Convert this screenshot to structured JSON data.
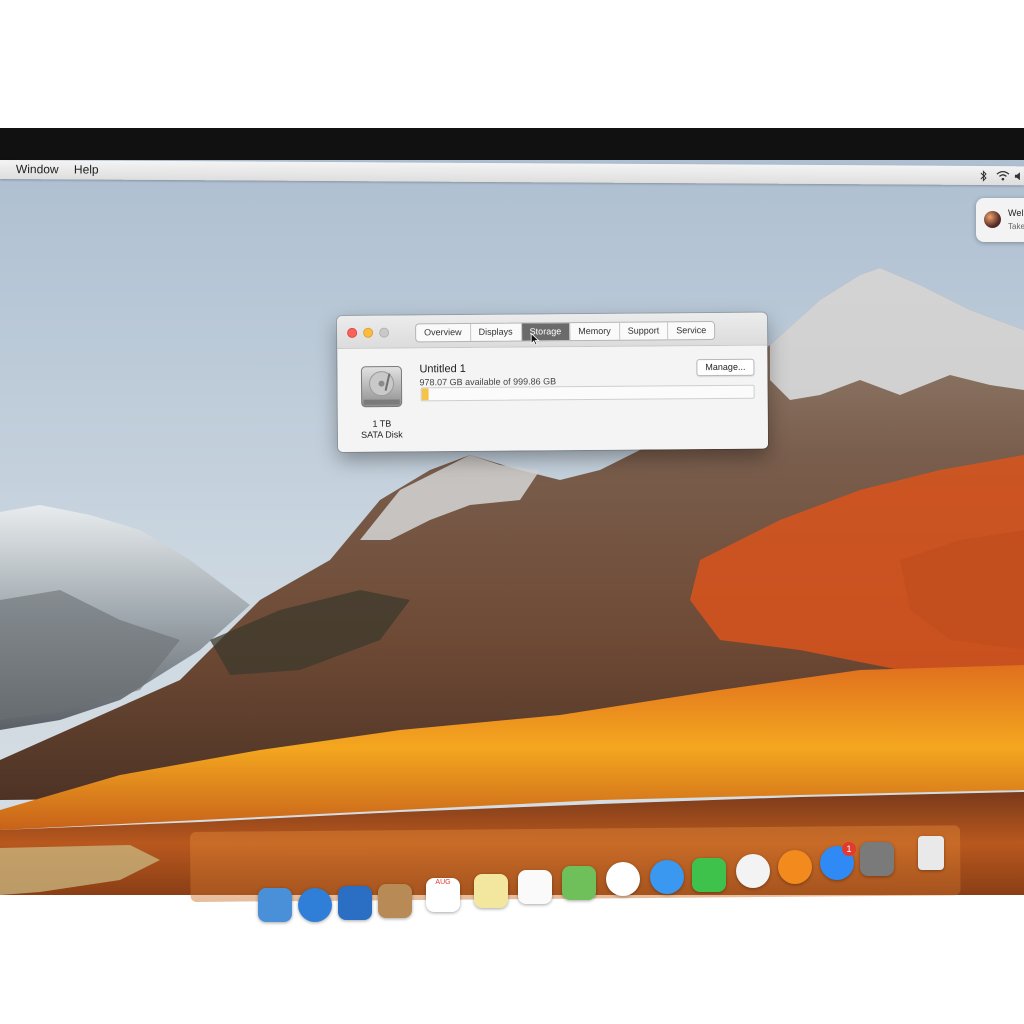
{
  "menubar": {
    "items": [
      {
        "label": "Window"
      },
      {
        "label": "Help"
      }
    ]
  },
  "notification": {
    "title": "Wel",
    "subtitle": "Take"
  },
  "window": {
    "tabs": [
      {
        "label": "Overview",
        "active": false
      },
      {
        "label": "Displays",
        "active": false
      },
      {
        "label": "Storage",
        "active": true
      },
      {
        "label": "Memory",
        "active": false
      },
      {
        "label": "Support",
        "active": false
      },
      {
        "label": "Service",
        "active": false
      }
    ],
    "disk": {
      "size": "1 TB",
      "type": "SATA Disk"
    },
    "volume": {
      "name": "Untitled 1",
      "availability": "978.07 GB available of 999.86 GB",
      "used_fraction": 0.022
    },
    "manage_label": "Manage...",
    "colors": {
      "bar_fill": "#f5c34a",
      "close": "#fc605c",
      "minimize": "#fdbc40",
      "zoom": "#c9c9c9"
    }
  },
  "dock": {
    "calendar_month": "AUG",
    "app_store_badge": "1",
    "icons": [
      "finder-icon",
      "safari-icon",
      "mail-icon",
      "contacts-icon",
      "calendar-icon",
      "notes-icon",
      "reminders-icon",
      "maps-icon",
      "photos-icon",
      "messages-icon",
      "facetime-icon",
      "itunes-icon",
      "ibooks-icon",
      "app-store-icon",
      "system-preferences-icon",
      "trash-icon"
    ]
  }
}
